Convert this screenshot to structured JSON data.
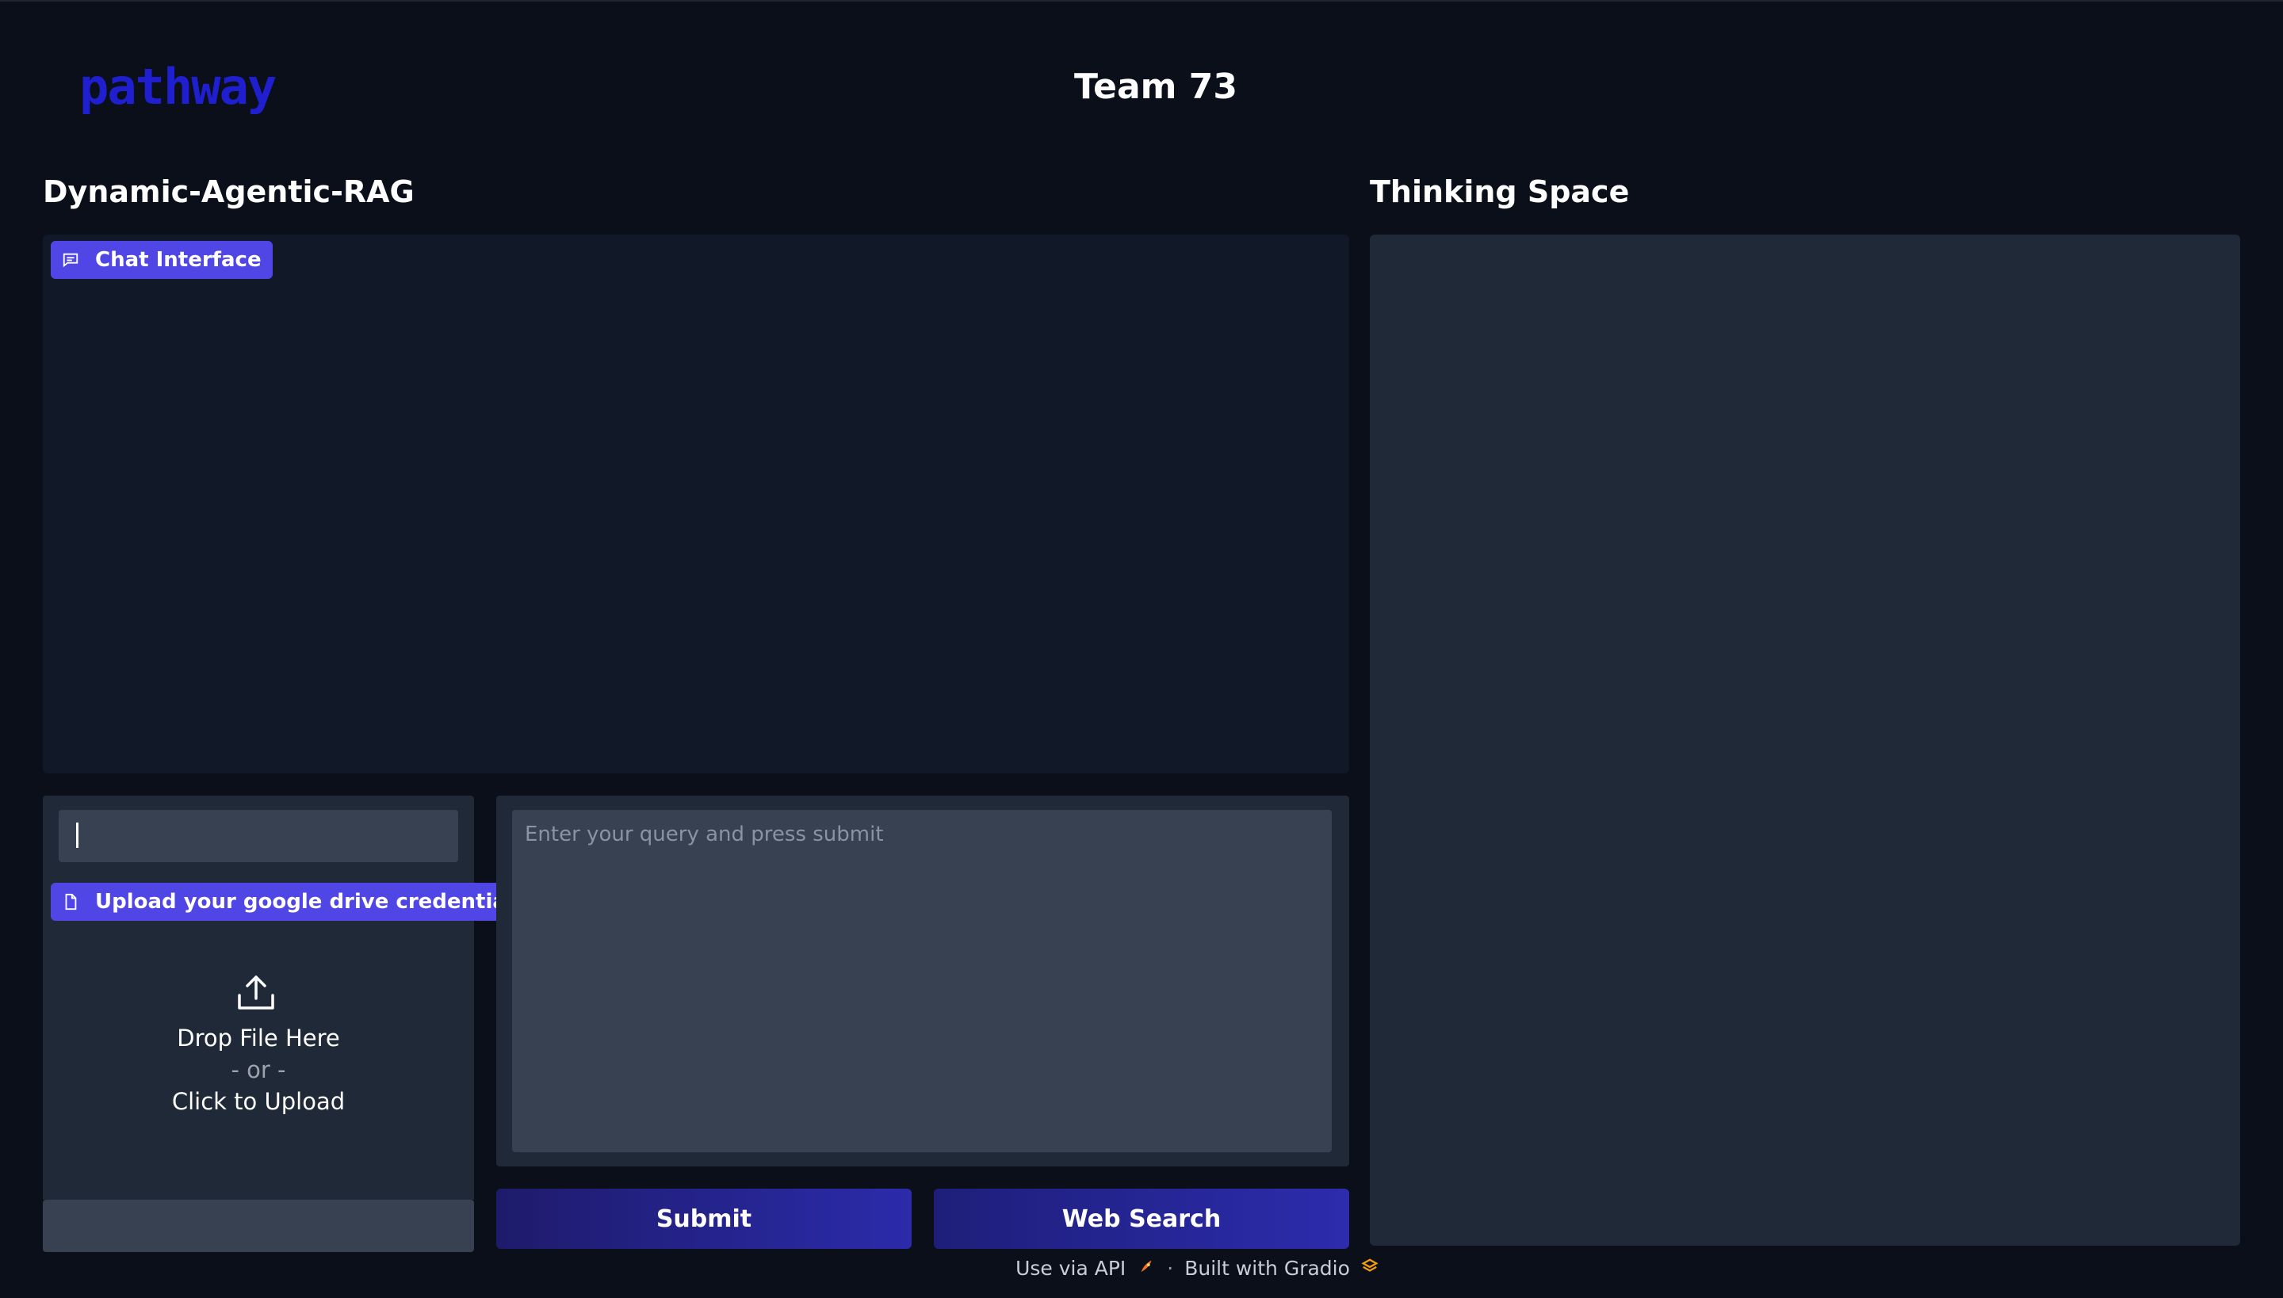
{
  "header": {
    "logo_text": "pathway",
    "title": "Team 73"
  },
  "left_section": {
    "heading": "Dynamic-Agentic-RAG",
    "chat_badge": "Chat Interface",
    "chat_icon": "chat-bubble-icon"
  },
  "right_section": {
    "heading": "Thinking Space"
  },
  "upload": {
    "badge": "Upload your google drive credentials",
    "badge_icon": "file-icon",
    "credentials_value": "",
    "drop_text": "Drop File Here",
    "or_text": "- or -",
    "click_text": "Click to Upload",
    "icon": "upload-icon"
  },
  "query": {
    "placeholder": "Enter your query and press submit",
    "value": ""
  },
  "buttons": {
    "submit": "Submit",
    "web_search": "Web Search"
  },
  "footer": {
    "api_link": "Use via API",
    "separator": "·",
    "built_with": "Built with Gradio",
    "api_icon": "rocket-icon",
    "gradio_icon": "gradio-logo-icon"
  },
  "colors": {
    "background": "#0b0f19",
    "panel": "#111827",
    "panel_alt": "#1f2937",
    "input": "#374151",
    "accent": "#4f46e5",
    "logo": "#1f1fcf",
    "button": "#2b2bab"
  }
}
